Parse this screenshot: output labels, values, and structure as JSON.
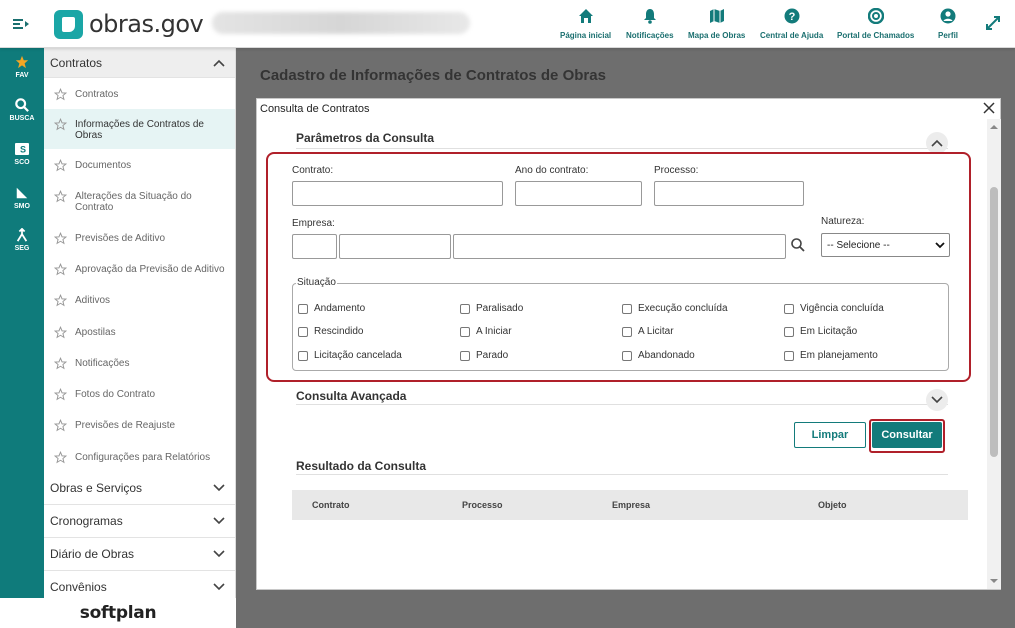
{
  "app": {
    "brand": "obras.gov",
    "footer_brand": "softplan"
  },
  "topnav": [
    {
      "label": "Página inicial",
      "icon": "home-icon"
    },
    {
      "label": "Notificações",
      "icon": "bell-icon"
    },
    {
      "label": "Mapa de Obras",
      "icon": "map-icon"
    },
    {
      "label": "Central de Ajuda",
      "icon": "help-icon"
    },
    {
      "label": "Portal de Chamados",
      "icon": "lifebuoy-icon"
    },
    {
      "label": "Perfil",
      "icon": "user-icon"
    }
  ],
  "rail": [
    {
      "label": "FAV",
      "icon": "star-icon"
    },
    {
      "label": "BUSCA",
      "icon": "search-icon"
    },
    {
      "label": "SCO",
      "icon": "sco-icon"
    },
    {
      "label": "SMO",
      "icon": "ruler-icon"
    },
    {
      "label": "SEG",
      "icon": "merge-icon"
    }
  ],
  "sidebar": {
    "open_section": "Contratos",
    "items": [
      "Contratos",
      "Informações de Contratos de Obras",
      "Documentos",
      "Alterações da Situação do Contrato",
      "Previsões de Aditivo",
      "Aprovação da Previsão de Aditivo",
      "Aditivos",
      "Apostilas",
      "Notificações",
      "Fotos do Contrato",
      "Previsões de Reajuste",
      "Configurações para Relatórios"
    ],
    "sections": [
      "Obras e Serviços",
      "Cronogramas",
      "Diário de Obras",
      "Convênios"
    ]
  },
  "page": {
    "title": "Cadastro de Informações de Contratos de Obras"
  },
  "modal": {
    "title": "Consulta de Contratos",
    "params_title": "Parâmetros da Consulta",
    "labels": {
      "contrato": "Contrato:",
      "ano": "Ano do contrato:",
      "processo": "Processo:",
      "empresa": "Empresa:",
      "natureza": "Natureza:"
    },
    "natureza_selected": "-- Selecione --",
    "situacao_legend": "Situação",
    "situacoes": [
      "Andamento",
      "Paralisado",
      "Execução concluída",
      "Vigência concluída",
      "Rescindido",
      "A Iniciar",
      "A Licitar",
      "Em Licitação",
      "Licitação cancelada",
      "Parado",
      "Abandonado",
      "Em planejamento"
    ],
    "advanced_title": "Consulta Avançada",
    "btn_clear": "Limpar",
    "btn_search": "Consultar",
    "result_title": "Resultado da Consulta",
    "columns": [
      "Contrato",
      "Processo",
      "Empresa",
      "Objeto"
    ]
  },
  "colors": {
    "primary": "#137b7b",
    "highlight": "#b0202a"
  }
}
